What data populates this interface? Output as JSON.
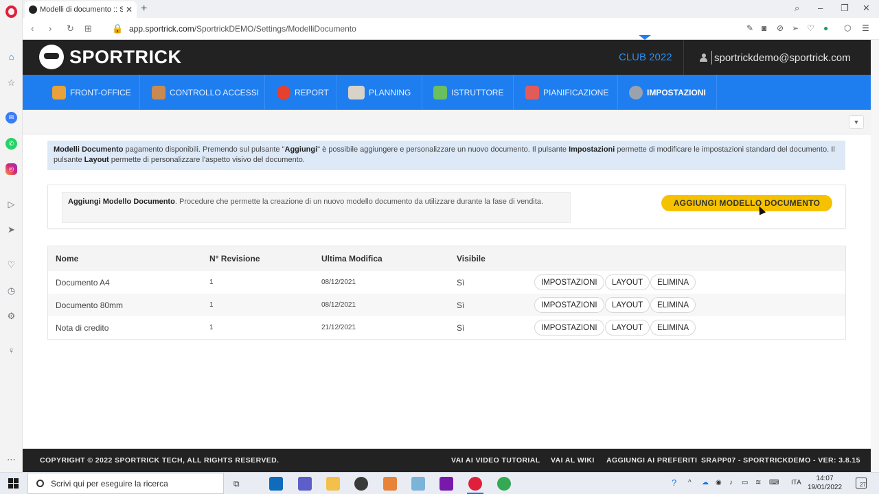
{
  "browser": {
    "tab_title": "Modelli di documento :: Sp",
    "new_tab": "+",
    "close": "✕",
    "url_prefix": "app.sportrick.com",
    "url_path": "/SportrickDEMO/Settings/ModelliDocumento"
  },
  "header": {
    "brand": "SPORTRICK",
    "club": "CLUB 2022",
    "user_email": "sportrickdemo@sportrick.com"
  },
  "nav": {
    "items": [
      {
        "label": "FRONT-OFFICE",
        "color": "#e9a13b"
      },
      {
        "label": "CONTROLLO ACCESSI",
        "color": "#c98a52"
      },
      {
        "label": "REPORT",
        "color": "#e4412f"
      },
      {
        "label": "PLANNING",
        "color": "#d8d2c8"
      },
      {
        "label": "ISTRUTTORE",
        "color": "#6bbf5e"
      },
      {
        "label": "PIANIFICAZIONE",
        "color": "#e25b5b"
      },
      {
        "label": "IMPOSTAZIONI",
        "color": "#9aa3ad"
      }
    ],
    "active": "IMPOSTAZIONI"
  },
  "info": {
    "b1": "Modelli Documento",
    "t1": " pagamento disponibili. Premendo sul pulsante \"",
    "b2": "Aggiungi",
    "t2": "\" è possibile aggiungere e personalizzare un nuovo documento. Il pulsante ",
    "b3": "Impostazioni",
    "t3": " permette di modificare le impostazioni standard del documento. Il pulsante ",
    "b4": "Layout",
    "t4": " permette di personalizzare l'aspetto visivo del documento."
  },
  "add_card": {
    "title": "Aggiungi Modello Documento",
    "desc": ". Procedure che permette la creazione di un nuovo modello documento da utilizzare durante la fase di vendita.",
    "button": "AGGIUNGI MODELLO DOCUMENTO"
  },
  "table": {
    "headers": {
      "nome": "Nome",
      "revisione": "N° Revisione",
      "modifica": "Ultima Modifica",
      "visibile": "Visibile"
    },
    "rows": [
      {
        "nome": "Documento A4",
        "revisione": "1",
        "modifica": "08/12/2021",
        "visibile": "Sì"
      },
      {
        "nome": "Documento 80mm",
        "revisione": "1",
        "modifica": "08/12/2021",
        "visibile": "Sì"
      },
      {
        "nome": "Nota di credito",
        "revisione": "1",
        "modifica": "21/12/2021",
        "visibile": "Sì"
      }
    ],
    "btn_settings": "IMPOSTAZIONI",
    "btn_layout": "LAYOUT",
    "btn_delete": "ELIMINA"
  },
  "footer": {
    "copyright": "COPYRIGHT © 2022 SPORTRICK TECH, ALL RIGHTS RESERVED.",
    "video": "VAI AI VIDEO TUTORIAL",
    "wiki": "VAI AL WIKI",
    "fav": "AGGIUNGI AI PREFERITI",
    "version": "SRAPP07 - SPORTRICKDEMO - VER: 3.8.15"
  },
  "taskbar": {
    "search_placeholder": "Scrivi qui per eseguire la ricerca",
    "lang": "ITA",
    "time": "14:07",
    "date": "19/01/2022",
    "notifications": "27"
  }
}
